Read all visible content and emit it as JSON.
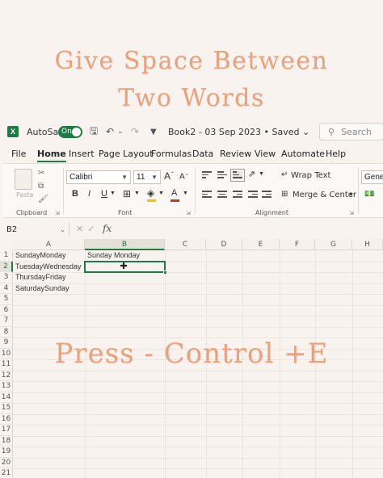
{
  "overlay": {
    "title_line1": "Give Space Between",
    "title_line2": "Two Words",
    "instruction": "Press - Control +E"
  },
  "titlebar": {
    "app_icon_letter": "X",
    "autosave_label": "AutoSave",
    "autosave_state": "On",
    "document_title": "Book2 - 03 Sep 2023 • Saved ⌄",
    "search_placeholder": "Search"
  },
  "menu": {
    "items": [
      "File",
      "Home",
      "Insert",
      "Page Layout",
      "Formulas",
      "Data",
      "Review",
      "View",
      "Automate",
      "Help"
    ],
    "active": "Home"
  },
  "ribbon": {
    "clipboard": {
      "paste_label": "Paste",
      "group_label": "Clipboard"
    },
    "font": {
      "font_name": "Calibri",
      "font_size": "11",
      "grow_label": "A",
      "shrink_label": "A",
      "bold": "B",
      "italic": "I",
      "underline": "U",
      "font_color_letter": "A",
      "group_label": "Font",
      "font_color": "#c0392b",
      "highlight_color": "#f1c40f"
    },
    "alignment": {
      "wrap_text": "Wrap Text",
      "merge_center": "Merge & Center",
      "group_label": "Alignment"
    },
    "number": {
      "format_label": "Genera"
    }
  },
  "formula_bar": {
    "name_box": "B2",
    "fx": "fx"
  },
  "sheet": {
    "columns": [
      "A",
      "B",
      "C",
      "D",
      "E",
      "F",
      "G",
      "H"
    ],
    "selected_column": "B",
    "rows": [
      "1",
      "2",
      "3",
      "4",
      "5",
      "6",
      "7",
      "8",
      "9",
      "10",
      "11",
      "12",
      "13",
      "14",
      "15",
      "16",
      "17",
      "18",
      "19",
      "20",
      "21"
    ],
    "selected_row": "2",
    "cells": {
      "A1": "SundayMonday",
      "A2": "TuesdayWednesday",
      "A3": "ThursdayFriday",
      "A4": "SaturdaySunday",
      "B1": "Sunday Monday"
    },
    "active_cell": "B2"
  },
  "colors": {
    "accent": "#1f7a45",
    "overlay_text": "#e8a27e",
    "background": "#f8f3ee"
  }
}
